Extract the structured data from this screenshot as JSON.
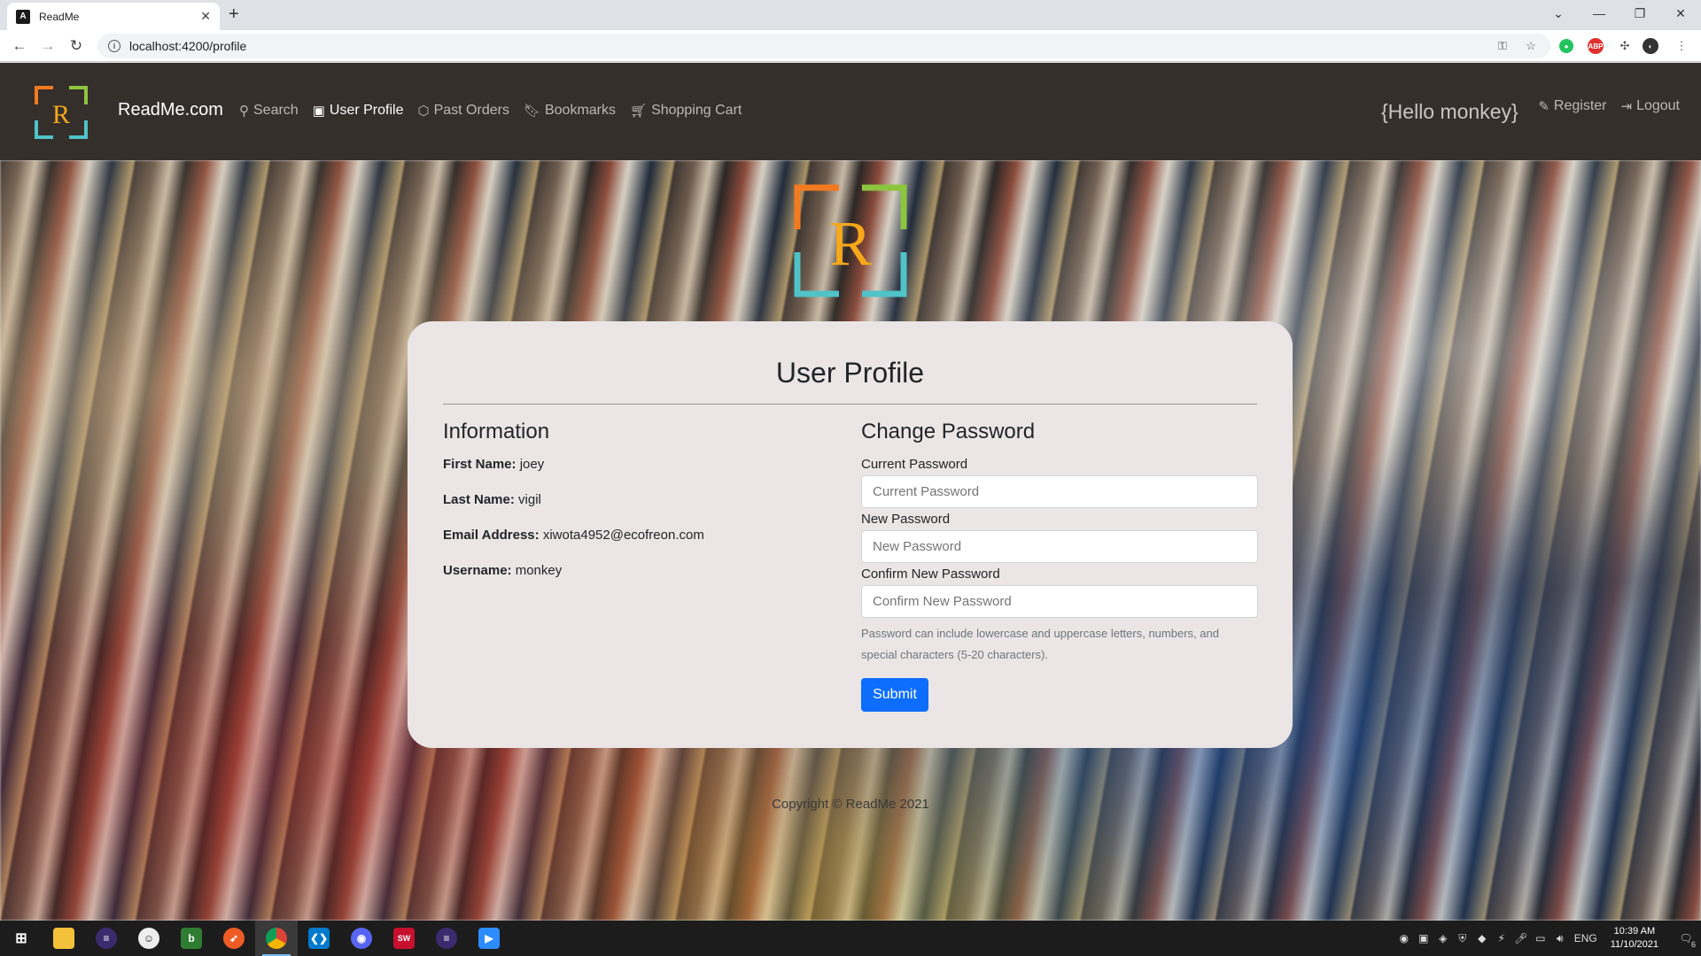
{
  "browser": {
    "tab_title": "ReadMe",
    "tab_favicon_letter": "A",
    "url": "localhost:4200/profile"
  },
  "navbar": {
    "logo_letter": "R",
    "brand": "ReadMe.com",
    "links": [
      {
        "label": "Search",
        "icon": "search-icon"
      },
      {
        "label": "User Profile",
        "icon": "person-badge-icon"
      },
      {
        "label": "Past Orders",
        "icon": "box-icon"
      },
      {
        "label": "Bookmarks",
        "icon": "bookmark-icon"
      },
      {
        "label": "Shopping Cart",
        "icon": "cart-icon"
      }
    ],
    "greeting": "{Hello monkey}",
    "register_label": "Register",
    "logout_label": "Logout"
  },
  "profile": {
    "title": "User Profile",
    "info_title": "Information",
    "fields": [
      {
        "label": "First Name:",
        "value": "joey"
      },
      {
        "label": "Last Name:",
        "value": "vigil"
      },
      {
        "label": "Email Address:",
        "value": "xiwota4952@ecofreon.com"
      },
      {
        "label": "Username:",
        "value": "monkey"
      }
    ],
    "password_title": "Change Password",
    "current_label": "Current Password",
    "current_placeholder": "Current Password",
    "new_label": "New Password",
    "new_placeholder": "New Password",
    "confirm_label": "Confirm New Password",
    "confirm_placeholder": "Confirm New Password",
    "help_text": "Password can include lowercase and uppercase letters, numbers, and special characters (5-20 characters).",
    "submit_label": "Submit"
  },
  "footer": {
    "copyright": "Copyright © ReadMe 2021"
  },
  "taskbar": {
    "language": "ENG",
    "time": "10:39 AM",
    "date": "11/10/2021",
    "notification_count": "6"
  },
  "colors": {
    "navbar_bg": "#352f2c",
    "card_bg": "#ebe6e5",
    "primary_button": "#0d6efd",
    "logo_orange": "#f47a20",
    "logo_green": "#8cc63f",
    "logo_teal": "#4fc3c8",
    "logo_letter": "#f7a81b"
  }
}
